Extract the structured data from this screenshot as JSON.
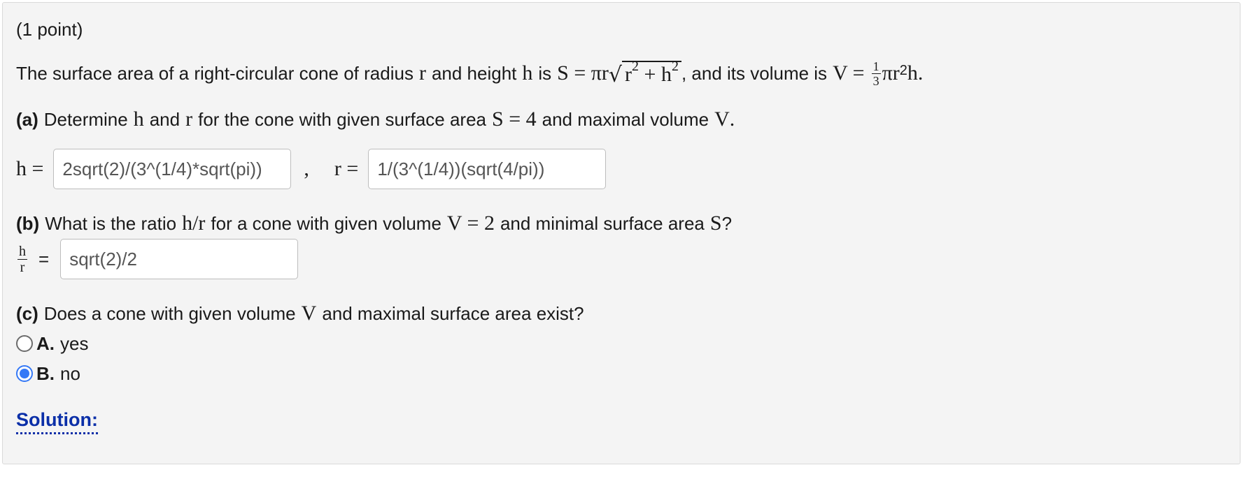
{
  "header": {
    "points": "(1 point)"
  },
  "intro": {
    "t1": "The surface area of a right-circular cone of radius",
    "r": "r",
    "t2": "and height",
    "h": "h",
    "t3": "is",
    "S_expr_lhs": "S = πr",
    "radicand_r": "r",
    "radicand_exp1": "2",
    "radicand_plus": " + h",
    "radicand_exp2": "2",
    "t4": ", and its volume is",
    "V_lhs": "V =",
    "frac_num": "1",
    "frac_den": "3",
    "V_rhs_a": "πr",
    "V_rhs_exp": "2",
    "V_rhs_b": "h."
  },
  "part_a": {
    "label": "(a)",
    "t1": "Determine",
    "h": "h",
    "t2": "and",
    "r": "r",
    "t3": "for the cone with given surface area",
    "cond": "S = 4",
    "t4": "and maximal volume",
    "V": "V",
    "period": ".",
    "h_label": "h =",
    "h_value": "2sqrt(2)/(3^(1/4)*sqrt(pi))",
    "sep": ",",
    "r_label": "r =",
    "r_value": "1/(3^(1/4))(sqrt(4/pi))"
  },
  "part_b": {
    "label": "(b)",
    "t1": "What is the ratio",
    "ratio": "h/r",
    "t2": "for a cone with given volume",
    "cond": "V = 2",
    "t3": "and minimal surface area",
    "S": "S",
    "q": "?",
    "frac_num": "h",
    "frac_den": "r",
    "eq": "=",
    "value": "sqrt(2)/2"
  },
  "part_c": {
    "label": "(c)",
    "t1": "Does a cone with given volume",
    "V": "V",
    "t2": "and maximal surface area exist?",
    "options": [
      {
        "letter": "A.",
        "text": "yes",
        "checked": false
      },
      {
        "letter": "B.",
        "text": "no",
        "checked": true
      }
    ]
  },
  "solution_link": "Solution:",
  "colors": {
    "accent": "#3478f6",
    "link": "#0b2fa8",
    "panel_bg": "#f4f4f4"
  }
}
